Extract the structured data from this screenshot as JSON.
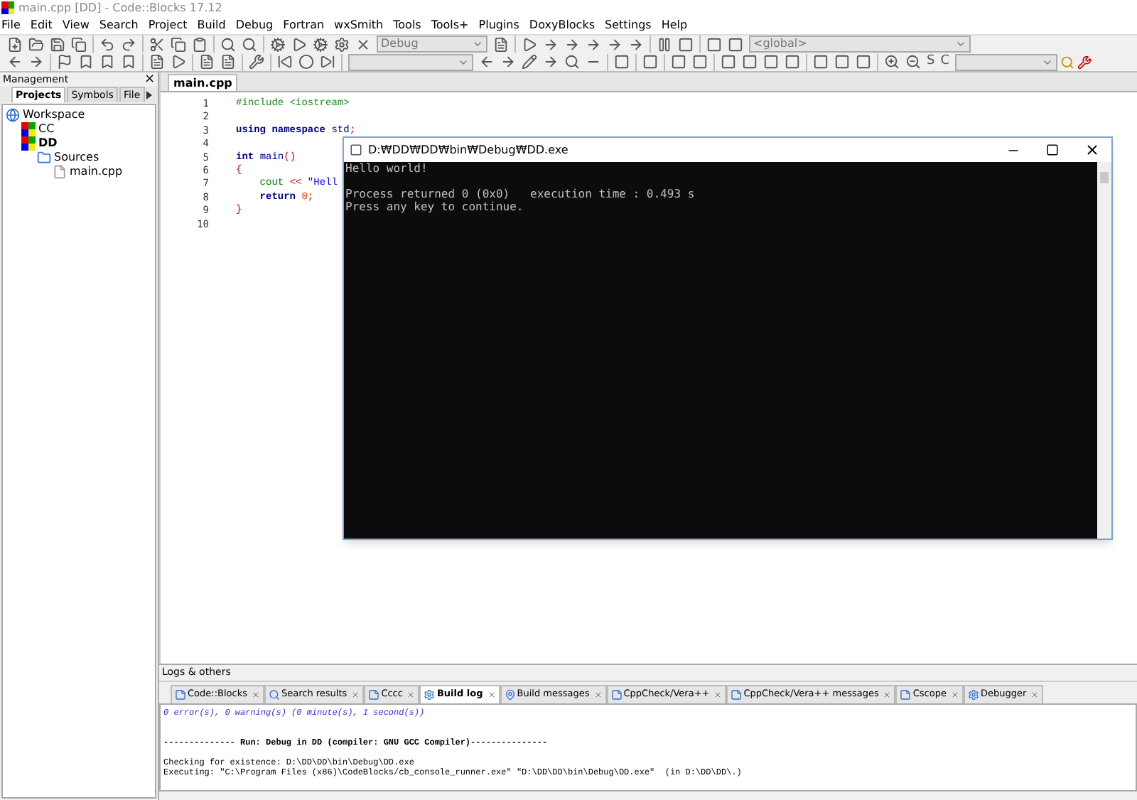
{
  "window": {
    "title": "main.cpp [DD] - Code::Blocks 17.12"
  },
  "menu": [
    "File",
    "Edit",
    "View",
    "Search",
    "Project",
    "Build",
    "Debug",
    "Fortran",
    "wxSmith",
    "Tools",
    "Tools+",
    "Plugins",
    "DoxyBlocks",
    "Settings",
    "Help"
  ],
  "toolbar": {
    "build_target": "Debug",
    "scope": "<global>",
    "glyph_buttons": [
      "S",
      "C"
    ]
  },
  "management": {
    "title": "Management",
    "close": "×",
    "tabs": [
      {
        "label": "Projects",
        "selected": true
      },
      {
        "label": "Symbols",
        "selected": false
      },
      {
        "label": "File",
        "selected": false
      }
    ],
    "tree": [
      {
        "label": "Workspace",
        "kind": "workspace",
        "children": [
          {
            "label": "CC",
            "kind": "project",
            "bold": false
          },
          {
            "label": "DD",
            "kind": "project",
            "bold": true,
            "children": [
              {
                "label": "Sources",
                "kind": "folder",
                "children": [
                  {
                    "label": "main.cpp",
                    "kind": "file"
                  }
                ]
              }
            ]
          }
        ]
      }
    ]
  },
  "editor": {
    "tabs": [
      {
        "label": "main.cpp",
        "selected": true
      }
    ],
    "lines": [
      {
        "number": "1",
        "code": [
          {
            "t": "#include <iostream>",
            "kind": "pre"
          }
        ]
      },
      {
        "number": "2"
      },
      {
        "number": "3",
        "code": [
          {
            "t": "using namespace ",
            "kind": "kw"
          },
          {
            "t": "std",
            "kind": "plain"
          },
          {
            "t": ";",
            "kind": "op"
          }
        ]
      },
      {
        "number": "4"
      },
      {
        "number": "5",
        "code": [
          {
            "t": "int ",
            "kind": "kw"
          },
          {
            "t": "main",
            "kind": "plain"
          },
          {
            "t": "()",
            "kind": "op"
          }
        ]
      },
      {
        "number": "6",
        "code": [
          {
            "t": "{",
            "kind": "op"
          }
        ]
      },
      {
        "number": "7",
        "code": [
          {
            "t": "    cout ",
            "kind": "ident"
          },
          {
            "t": "<< ",
            "kind": "op"
          },
          {
            "t": "\"Hell",
            "kind": "str"
          }
        ]
      },
      {
        "number": "8",
        "code": [
          {
            "t": "    return ",
            "kind": "kw"
          },
          {
            "t": "0",
            "kind": "num"
          },
          {
            "t": ";",
            "kind": "op"
          }
        ]
      },
      {
        "number": "9",
        "code": [
          {
            "t": "}",
            "kind": "op"
          }
        ]
      },
      {
        "number": "10"
      }
    ]
  },
  "console": {
    "title": "D:₩DD₩DD₩bin₩Debug₩DD.exe",
    "lines": [
      {
        "text": "Hello world!",
        "kind": "text"
      },
      {
        "kind": "blank"
      },
      {
        "text": "Process returned 0 (0x0)   execution time : 0.493 s",
        "kind": "text"
      },
      {
        "text": "Press any key to continue.",
        "kind": "text"
      }
    ]
  },
  "logs": {
    "title": "Logs & others",
    "tabs": [
      {
        "label": "Code::Blocks",
        "selected": false
      },
      {
        "label": "Search results",
        "selected": false
      },
      {
        "label": "Cccc",
        "selected": false
      },
      {
        "label": "Build log",
        "selected": true
      },
      {
        "label": "Build messages",
        "selected": false
      },
      {
        "label": "CppCheck/Vera++",
        "selected": false
      },
      {
        "label": "CppCheck/Vera++ messages",
        "selected": false
      },
      {
        "label": "Cscope",
        "selected": false
      },
      {
        "label": "Debugger",
        "selected": false
      }
    ],
    "lines": [
      {
        "text": "0 error(s), 0 warning(s) (0 minute(s), 1 second(s))",
        "kind": "summary"
      },
      {
        "kind": "blank"
      },
      {
        "kind": "blank"
      },
      {
        "text": "-------------- Run: Debug in DD (compiler: GNU GCC Compiler)---------------",
        "kind": "header"
      },
      {
        "kind": "blank"
      },
      {
        "text": "Checking for existence: D:\\DD\\DD\\bin\\Debug\\DD.exe",
        "kind": "plain"
      },
      {
        "text": "Executing: \"C:\\Program Files (x86)\\CodeBlocks/cb_console_runner.exe\" \"D:\\DD\\DD\\bin\\Debug\\DD.exe\"  (in D:\\DD\\DD\\.)",
        "kind": "plain"
      }
    ]
  }
}
